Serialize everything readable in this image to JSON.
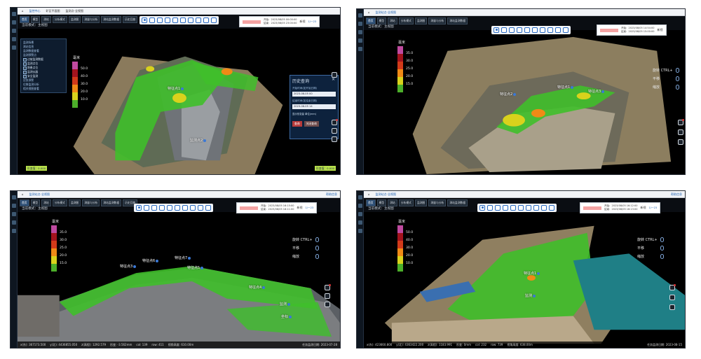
{
  "common": {
    "tabs": [
      "监控中心",
      "监测站点-全视图",
      "矿区平面图",
      "监测点-全视图"
    ],
    "toolbar": [
      "首页",
      "模型",
      "测站",
      "分析模式",
      "监测图",
      "测量与分析",
      "测站监测数据",
      "历史回放"
    ],
    "help": "帮助信息",
    "mode": "当前模式：主视图",
    "unit": "毫米",
    "rotate": "旋转",
    "ctrl": "CTRL+",
    "pan": "平移",
    "zoom": "缩放",
    "start_prefix": "开始：",
    "end_prefix": "结束：",
    "page_label": "新视",
    "page_nav": "1/一23"
  },
  "panel1": {
    "legend": [
      "50.0",
      "40.0",
      "30.0",
      "20.0",
      "10.0"
    ],
    "start": "2023/08/05 00:00:00",
    "end": "2023/08/05 23:00:00",
    "markers": [
      {
        "label": "特征点1"
      },
      {
        "label": "监测点2"
      }
    ],
    "left_menu": [
      "监测场景",
      "测站信息",
      "监测数据查看",
      "监测预警点",
      "边坡监测数据",
      "监测点位",
      "隐患点位",
      "监测仪器",
      "安全监测",
      "应急预警",
      "位移监测分析",
      "相关视图查看"
    ],
    "left_menu_checked": [
      4,
      5,
      6,
      7,
      8
    ],
    "history": {
      "title": "历史查询",
      "start_label": "开始时间(如开始日期)",
      "start_value": "2023-08-05 00",
      "end_label": "结束时间(如结束日期)",
      "end_value": "2023-08-05 14",
      "checkbox": "显示形变量  单位(mm)",
      "confirm": "查询",
      "cancel": "关闭查询"
    },
    "green_left": "形变值：0.000",
    "green_right": "形变值：0.000"
  },
  "panel2": {
    "legend": [
      "35.0",
      "30.0",
      "25.0",
      "20.0",
      "15.0"
    ],
    "start": "2023/08/05 14:54:00",
    "end": "2023/08/05 15:00:00",
    "markers": [
      {
        "label": "特征点2"
      },
      {
        "label": "特征点1"
      },
      {
        "label": "特征点3"
      }
    ]
  },
  "panel3": {
    "legend": [
      "35.0",
      "30.0",
      "25.0",
      "20.0",
      "15.0"
    ],
    "start": "2023/08/05 16:15:00",
    "end": "2023/08/05 18:11:00",
    "markers": [
      {
        "label": "特征点3"
      },
      {
        "label": "特征点6"
      },
      {
        "label": "特征点7"
      },
      {
        "label": "特征点5"
      },
      {
        "label": "特征点4"
      },
      {
        "label": "监测"
      },
      {
        "label": "坐标"
      }
    ],
    "status": {
      "x": "x(东): 367173.500",
      "y": "y(北): 4436855.050",
      "z": "z(高程): 1292.579",
      "deform": "形变: -3.562mm",
      "col": "col: 139",
      "row": "row: 411",
      "dist": "视角高度: 610.00m",
      "date": "任务监测日期: 2023-07-28"
    }
  },
  "panel4": {
    "legend": [
      "50.0",
      "40.0",
      "30.0",
      "20.0",
      "10.0"
    ],
    "start": "2023/08/05 16:12:00",
    "end": "2023/08/05 16:13:00",
    "markers": [
      {
        "label": "特征点1"
      },
      {
        "label": "监测"
      }
    ],
    "status": {
      "x": "x(东): 423660.800",
      "y": "y(北): 4363422.200",
      "z": "z(高程): 1183.991",
      "deform": "形变: 0mm",
      "col": "col: 232",
      "row": "row: 739",
      "dist": "视角高度: 638.00m",
      "date": "任务监测日期: 2023-08-15"
    }
  },
  "colors": {
    "legend_swatches": [
      "#c04aa0",
      "#a3131d",
      "#d23a1a",
      "#f08a16",
      "#d9d21c",
      "#4caf2a"
    ],
    "terrain_green": "#3fbf2a",
    "water": "#1f7f86"
  }
}
